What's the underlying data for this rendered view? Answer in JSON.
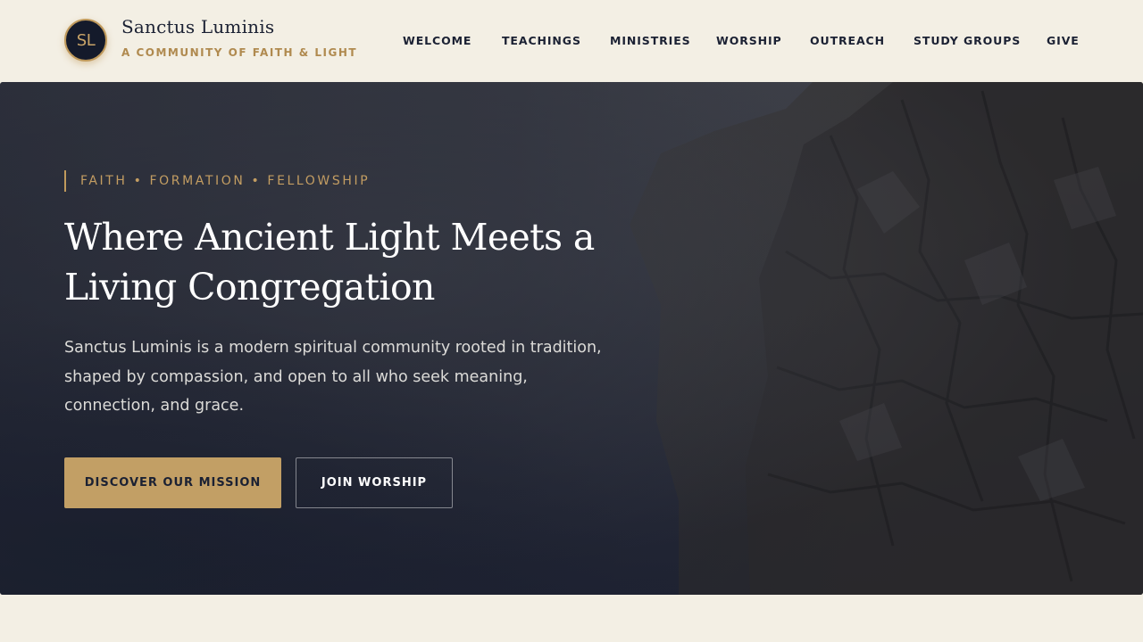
{
  "colors": {
    "page_background": "#f3efe4",
    "navy": "#1b2133",
    "gold": "#c29f65",
    "gold_text": "#b08a4f",
    "hero_dark": "#2b2e39"
  },
  "brand": {
    "logo_initials": "SL",
    "name": "Sanctus Luminis",
    "tagline": "A COMMUNITY OF FAITH & LIGHT"
  },
  "nav": {
    "items": [
      {
        "label": "WELCOME"
      },
      {
        "label": "TEACHINGS"
      },
      {
        "label": "MINISTRIES"
      },
      {
        "label": "WORSHIP"
      },
      {
        "label": "OUTREACH"
      },
      {
        "label": "STUDY GROUPS"
      },
      {
        "label": "GIVE"
      }
    ]
  },
  "hero": {
    "eyebrow": "FAITH • FORMATION • FELLOWSHIP",
    "title": "Where Ancient Light Meets a Living Congregation",
    "description": "Sanctus Luminis is a modern spiritual community rooted in tradition, shaped by compassion, and open to all who seek meaning, connection, and grace.",
    "primary_button": "DISCOVER OUR MISSION",
    "secondary_button": "JOIN WORSHIP",
    "background_image": "misty-rock-cliff"
  }
}
